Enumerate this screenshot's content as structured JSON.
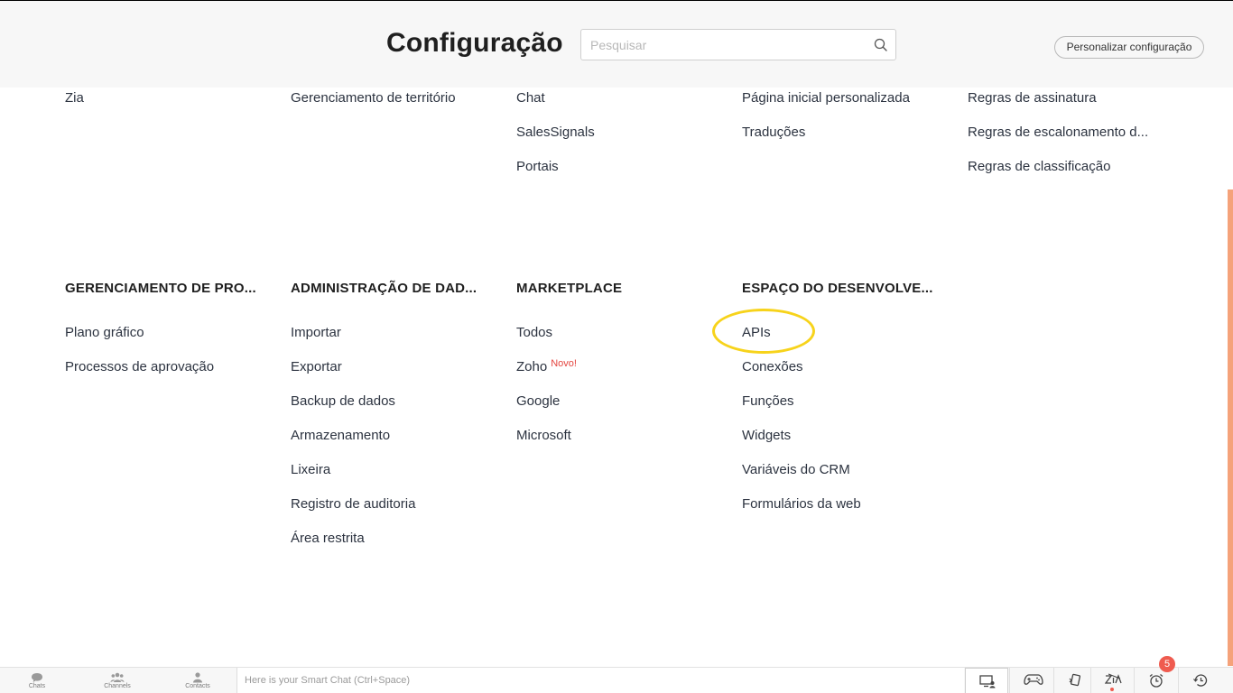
{
  "header": {
    "title": "Configuração",
    "search_placeholder": "Pesquisar",
    "personalize_label": "Personalizar configuração"
  },
  "top_section": {
    "columns": [
      [
        "Zia"
      ],
      [
        "Gerenciamento de território"
      ],
      [
        "Chat",
        "SalesSignals",
        "Portais"
      ],
      [
        "Página inicial personalizada",
        "Traduções"
      ],
      [
        "Regras de assinatura",
        "Regras de escalonamento d...",
        "Regras de classificação"
      ]
    ]
  },
  "sections": [
    {
      "heading": "GERENCIAMENTO DE PRO...",
      "items": [
        "Plano gráfico",
        "Processos de aprovação"
      ]
    },
    {
      "heading": "ADMINISTRAÇÃO DE DAD...",
      "items": [
        "Importar",
        "Exportar",
        "Backup de dados",
        "Armazenamento",
        "Lixeira",
        "Registro de auditoria",
        "Área restrita"
      ]
    },
    {
      "heading": "MARKETPLACE",
      "items": [
        "Todos",
        "Zoho",
        "Google",
        "Microsoft"
      ],
      "zoho_badge": "Novo!"
    },
    {
      "heading": "ESPAÇO DO DESENVOLVE...",
      "items": [
        "APIs",
        "Conexões",
        "Funções",
        "Widgets",
        "Variáveis do CRM",
        "Formulários da web"
      ]
    }
  ],
  "bottom_bar": {
    "nav": [
      "Chats",
      "Channels",
      "Contacts"
    ],
    "smart_chat_placeholder": "Here is your Smart Chat (Ctrl+Space)",
    "tools": [
      "screen-share-icon",
      "gamepad-icon",
      "sync-icon",
      "zia-icon",
      "alarm-clock-icon",
      "history-icon"
    ],
    "notification_count": "5"
  },
  "colors": {
    "accent": "#f5a27a",
    "highlight": "#f7d31b",
    "badge": "#ef5b4f",
    "new_label": "#e4453f"
  }
}
